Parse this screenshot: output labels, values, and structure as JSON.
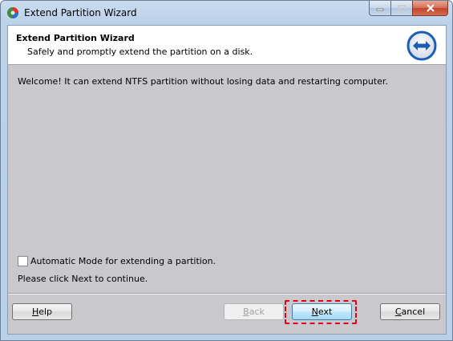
{
  "window": {
    "title": "Extend Partition Wizard"
  },
  "header": {
    "title": "Extend Partition Wizard",
    "subtitle": "Safely and promptly extend the partition on a disk."
  },
  "main": {
    "welcome_text": "Welcome! It can extend NTFS partition without losing data and restarting computer.",
    "automatic_mode_label": "Automatic Mode for extending a partition.",
    "automatic_mode_checked": false,
    "instruction_text": "Please click Next to continue."
  },
  "buttons": {
    "help": {
      "mnemonic": "H",
      "rest": "elp"
    },
    "back": {
      "mnemonic": "B",
      "rest": "ack",
      "enabled": false
    },
    "next": {
      "mnemonic": "N",
      "rest": "ext"
    },
    "cancel": {
      "mnemonic": "C",
      "rest": "ancel"
    }
  },
  "icons": {
    "app": "partition-wizard-app-icon",
    "header": "extend-arrows-icon",
    "minimize": "minimize-icon",
    "maximize": "maximize-icon",
    "close": "close-icon"
  },
  "colors": {
    "highlight_border": "#e0001b",
    "header_icon_blue": "#1a5fb4"
  }
}
